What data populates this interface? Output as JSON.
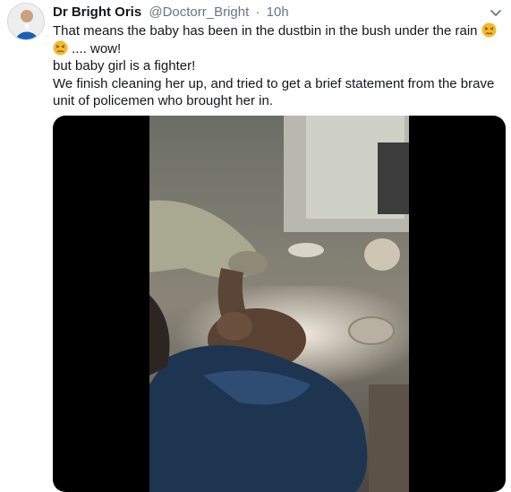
{
  "tweet": {
    "author": {
      "display_name": "Dr Bright Oris",
      "handle": "@Doctorr_Bright",
      "separator": "·",
      "timestamp": "10h",
      "avatar_icon": "profile-photo"
    },
    "menu_icon": "chevron-down-icon",
    "body": {
      "line1": "That means the baby has been in the dustbin in the bush under the rain",
      "line2": ".... wow!",
      "line3": "but baby girl is a fighter!",
      "line4": "We finish cleaning her up, and tried to get a brief statement from the brave unit of policemen who brought her in.",
      "emoji": "persevering-face-emoji"
    },
    "media": {
      "type": "video",
      "background_color": "#000000"
    }
  },
  "colors": {
    "text_primary": "#14171a",
    "text_secondary": "#657786",
    "emoji_face": "#f5b82e"
  }
}
